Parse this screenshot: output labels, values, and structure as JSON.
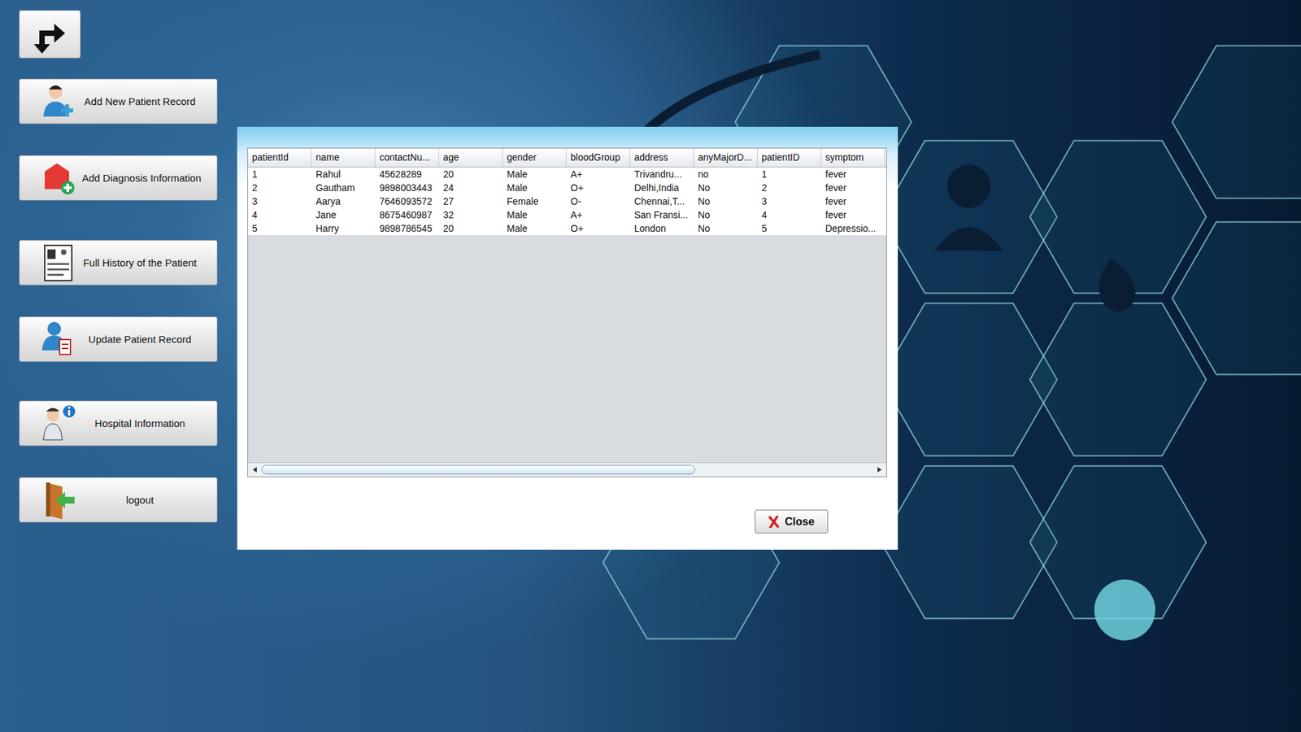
{
  "sidebar": {
    "items": [
      {
        "label": "Add New Patient Record"
      },
      {
        "label": "Add Diagnosis Information"
      },
      {
        "label": "Full History of the Patient"
      },
      {
        "label": "Update Patient Record"
      },
      {
        "label": "Hospital Information"
      },
      {
        "label": "logout"
      }
    ]
  },
  "dialog": {
    "table": {
      "columns": [
        "patientId",
        "name",
        "contactNu...",
        "age",
        "gender",
        "bloodGroup",
        "address",
        "anyMajorD...",
        "patientID",
        "symptom"
      ],
      "rows": [
        [
          "1",
          "Rahul",
          "45628289",
          "20",
          "Male",
          "A+",
          "Trivandru...",
          "no",
          "1",
          "fever"
        ],
        [
          "2",
          "Gautham",
          "9898003443",
          "24",
          "Male",
          "O+",
          "Delhi,India",
          "No",
          "2",
          "fever"
        ],
        [
          "3",
          "Aarya",
          "7646093572",
          "27",
          "Female",
          "O-",
          "Chennai,T...",
          "No",
          "3",
          "fever"
        ],
        [
          "4",
          "Jane",
          "8675460987",
          "32",
          "Male",
          "A+",
          "San Fransi...",
          "No",
          "4",
          "fever"
        ],
        [
          "5",
          "Harry",
          "9898786545",
          "20",
          "Male",
          "O+",
          "London",
          "No",
          "5",
          "Depressio..."
        ]
      ],
      "scrollbar": {
        "level": 0.71
      }
    },
    "buttons": [
      {
        "label": "Close"
      }
    ]
  }
}
